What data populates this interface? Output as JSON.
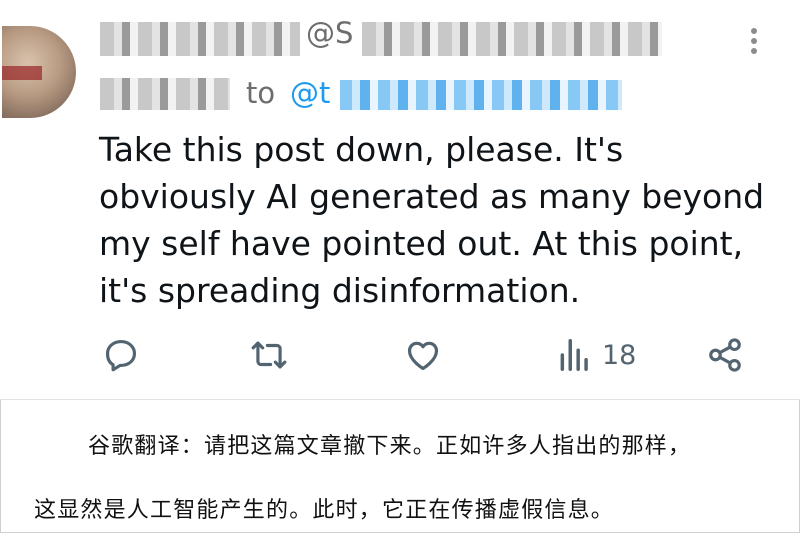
{
  "tweet": {
    "handle_visible": "@S",
    "reply_prefix": "to",
    "reply_handle_visible": "@t",
    "body_lines": [
      "Take this post down, please. It's",
      "obviously AI generated as many beyond",
      "my self have pointed out. At this point,",
      "it's spreading disinformation."
    ],
    "actions": {
      "reply_icon": "reply-bubble-icon",
      "retweet_icon": "retweet-icon",
      "like_icon": "heart-icon",
      "views_icon": "views-bar-chart-icon",
      "views_count": "18",
      "share_icon": "share-icon"
    },
    "colors": {
      "text": "#0f1419",
      "muted": "#536471",
      "link": "#1d9bf0"
    }
  },
  "translation": {
    "line1": "谷歌翻译：请把这篇文章撤下来。正如许多人指出的那样，",
    "line2": "这显然是人工智能产生的。此时，它正在传播虚假信息。"
  }
}
